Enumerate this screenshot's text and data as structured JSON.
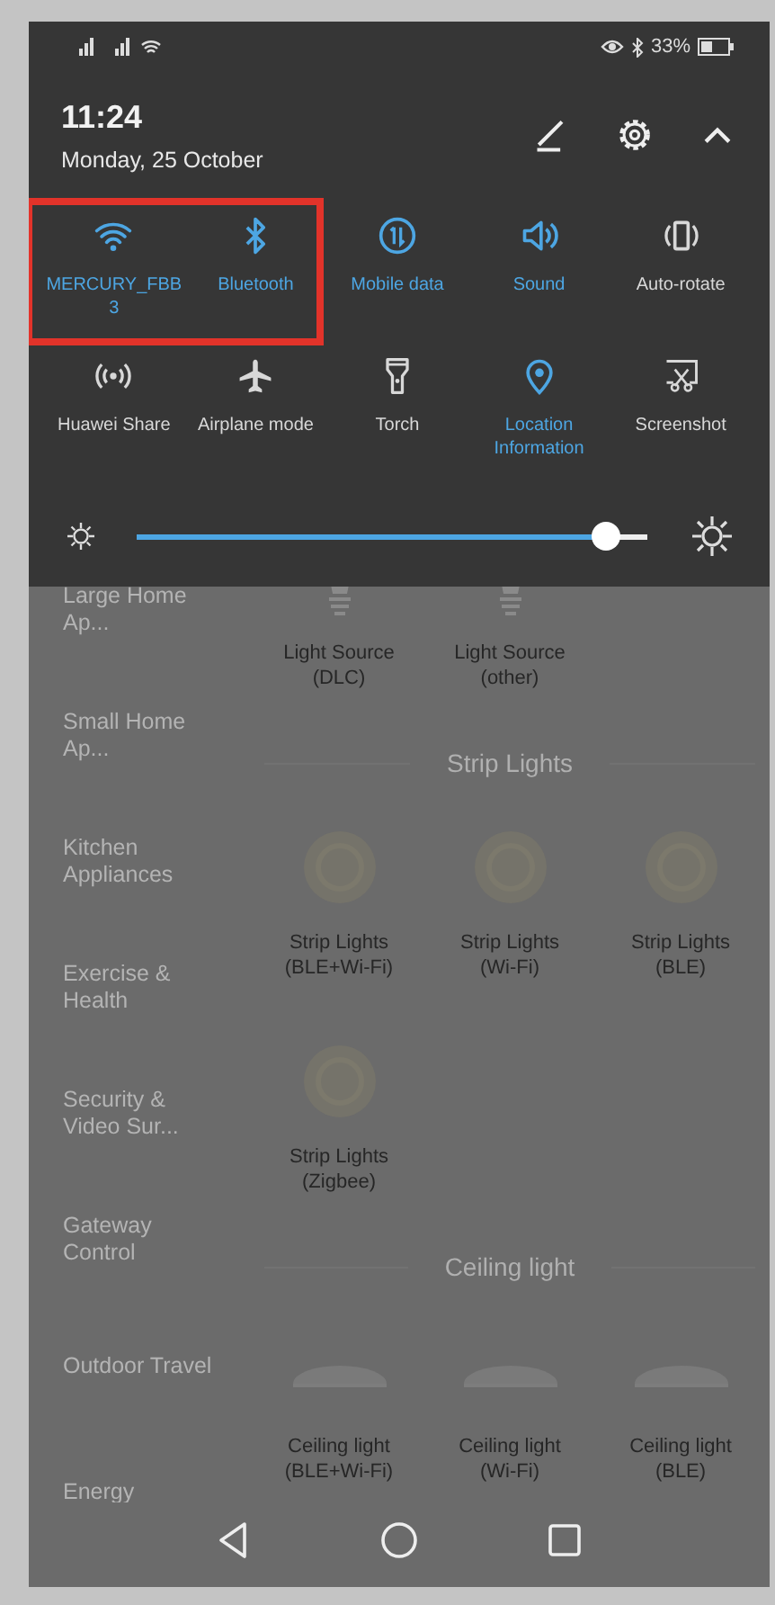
{
  "status_bar": {
    "battery": "33%"
  },
  "header": {
    "time": "11:24",
    "date": "Monday, 25 October"
  },
  "tiles": [
    {
      "kind": "wifi",
      "label": "MERCURY_FBB3",
      "on": true,
      "highlighted": true
    },
    {
      "kind": "bluetooth",
      "label": "Bluetooth",
      "on": true,
      "highlighted": true
    },
    {
      "kind": "data",
      "label": "Mobile data",
      "on": true,
      "highlighted": false
    },
    {
      "kind": "sound",
      "label": "Sound",
      "on": true,
      "highlighted": false
    },
    {
      "kind": "rotate",
      "label": "Auto-rotate",
      "on": false,
      "highlighted": false
    },
    {
      "kind": "share",
      "label": "Huawei Share",
      "on": false,
      "highlighted": false
    },
    {
      "kind": "airplane",
      "label": "Airplane mode",
      "on": false,
      "highlighted": false
    },
    {
      "kind": "torch",
      "label": "Torch",
      "on": false,
      "highlighted": false
    },
    {
      "kind": "location",
      "label": "Location Information",
      "on": true,
      "highlighted": false
    },
    {
      "kind": "screenshot",
      "label": "Screenshot",
      "on": false,
      "highlighted": false
    }
  ],
  "brightness": {
    "level": 0.92
  },
  "app": {
    "categories": [
      "Large Home Ap...",
      "Small Home Ap...",
      "Kitchen Appliances",
      "Exercise & Health",
      "Security & Video Sur...",
      "Gateway Control",
      "Outdoor Travel",
      "Energy"
    ],
    "blocks": [
      {
        "kind": "devices",
        "items": [
          {
            "kind": "bulb",
            "label": "Light Source\n(DLC)"
          },
          {
            "kind": "bulb",
            "label": "Light Source\n(other)"
          }
        ]
      },
      {
        "kind": "heading",
        "title": "Strip Lights"
      },
      {
        "kind": "devices",
        "items": [
          {
            "kind": "strip",
            "label": "Strip Lights\n(BLE+Wi-Fi)"
          },
          {
            "kind": "strip",
            "label": "Strip Lights\n(Wi-Fi)"
          },
          {
            "kind": "strip",
            "label": "Strip Lights\n(BLE)"
          }
        ]
      },
      {
        "kind": "devices",
        "items": [
          {
            "kind": "strip",
            "label": "Strip Lights\n(Zigbee)"
          }
        ]
      },
      {
        "kind": "heading",
        "title": "Ceiling light"
      },
      {
        "kind": "devices",
        "items": [
          {
            "kind": "ceiling",
            "label": "Ceiling light\n(BLE+Wi-Fi)"
          },
          {
            "kind": "ceiling",
            "label": "Ceiling light\n(Wi-Fi)"
          },
          {
            "kind": "ceiling",
            "label": "Ceiling light\n(BLE)"
          }
        ]
      }
    ]
  }
}
